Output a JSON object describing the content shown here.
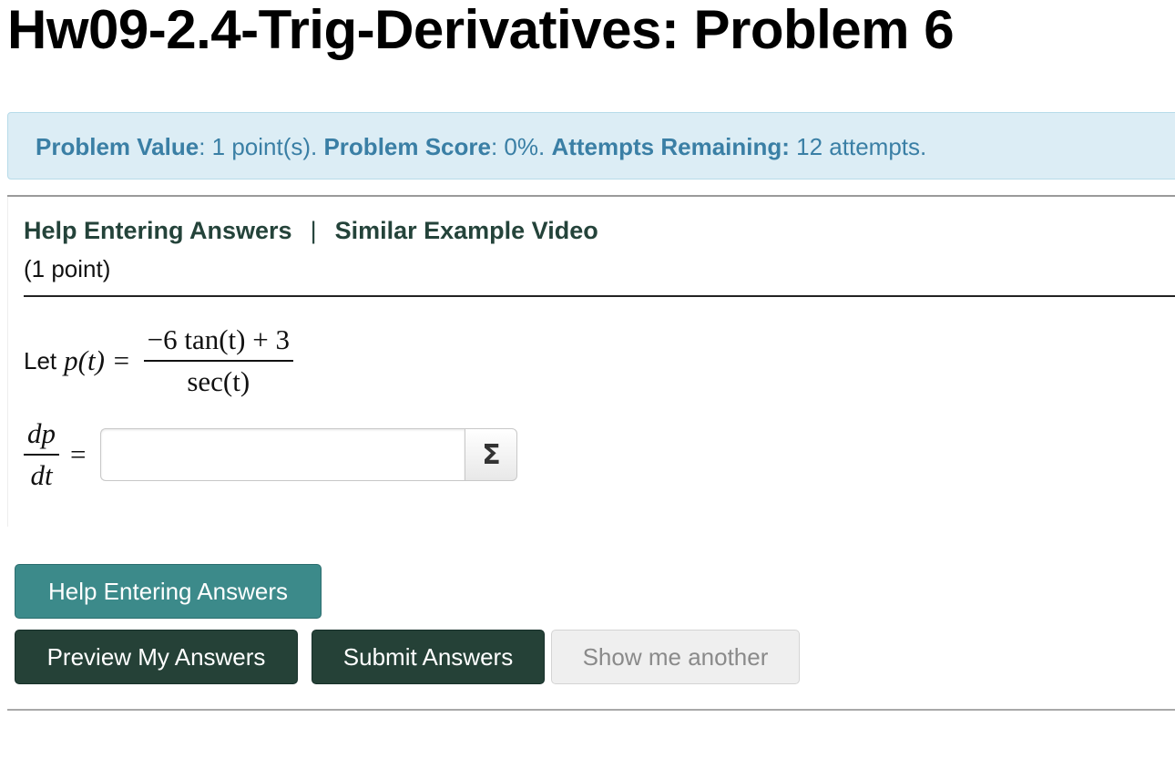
{
  "page": {
    "title": "Hw09-2.4-Trig-Derivatives: Problem 6"
  },
  "info": {
    "value_label": "Problem Value",
    "value_text": ": 1 point(s). ",
    "score_label": "Problem Score",
    "score_text": ": 0%. ",
    "attempts_label": "Attempts Remaining:",
    "attempts_text": " 12 attempts."
  },
  "problem": {
    "help_link": "Help Entering Answers",
    "separator": "|",
    "video_link": "Similar Example Video",
    "points": "(1 point)",
    "let_label": "Let",
    "function_lhs": "p(t) =",
    "numerator": "−6 tan(t) + 3",
    "denominator": "sec(t)",
    "deriv_num": "dp",
    "deriv_den": "dt",
    "equals": "=",
    "answer_value": "",
    "answer_placeholder": "",
    "sigma_label": "Σ"
  },
  "buttons": {
    "help": "Help Entering Answers",
    "preview": "Preview My Answers",
    "submit": "Submit Answers",
    "another": "Show me another"
  },
  "colors": {
    "info_bg": "#dcedf5",
    "info_text": "#3a7fa5",
    "teal_button": "#3c8a8a",
    "dark_button": "#254137",
    "link": "#24433a"
  }
}
